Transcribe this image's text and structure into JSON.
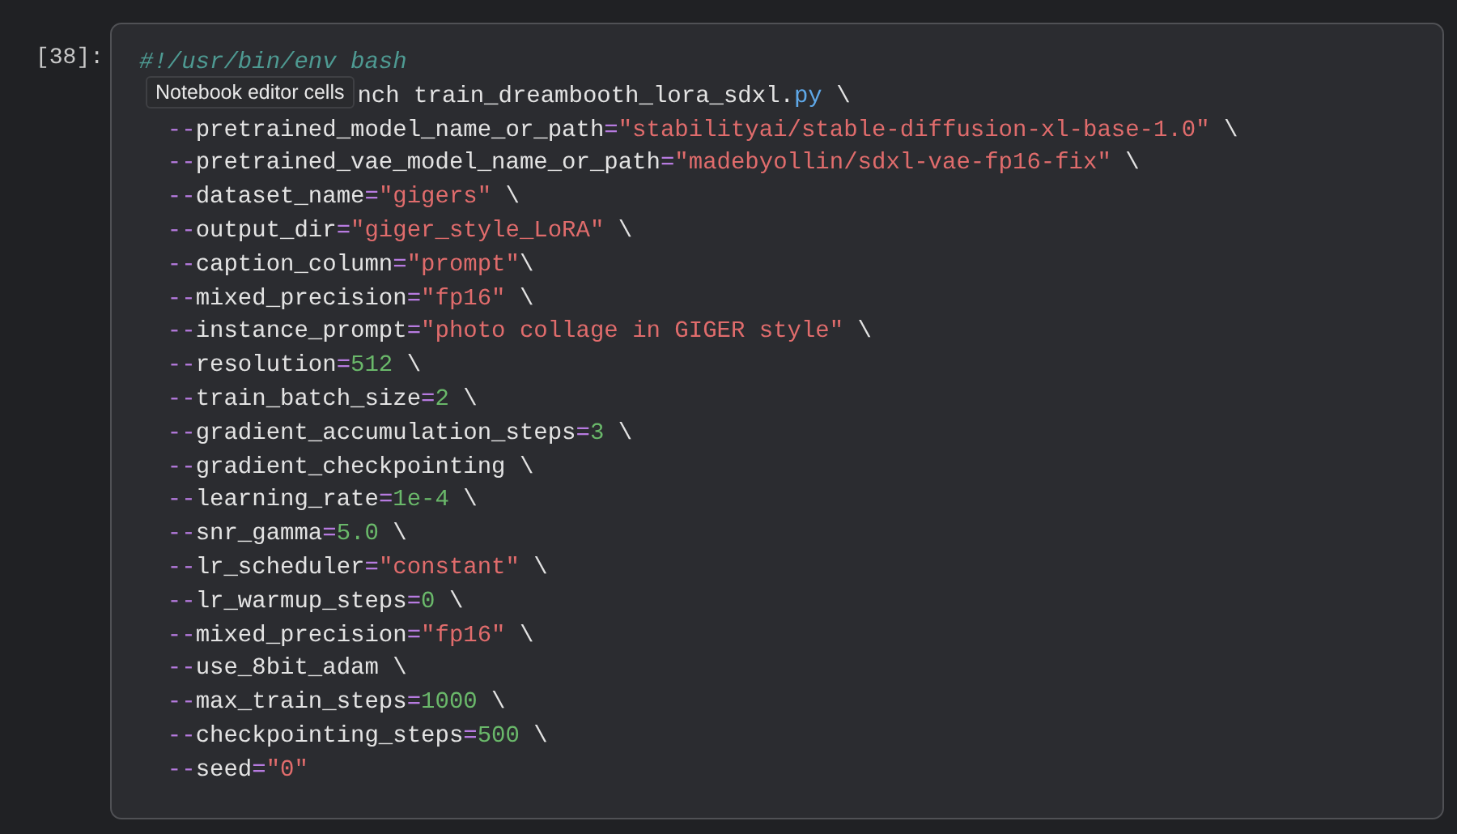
{
  "cell": {
    "prompt": "[38]:",
    "lines": [
      {
        "parts": [
          {
            "kind": "comment",
            "text": "#!/usr/bin/env bash"
          }
        ]
      },
      {
        "tooltip": "Notebook editor cells",
        "parts": [
          {
            "kind": "plain",
            "text": "nch train_dreambooth_lora_sdxl."
          },
          {
            "kind": "module",
            "text": "py"
          },
          {
            "kind": "plain",
            "text": " \\"
          }
        ]
      },
      {
        "parts": [
          {
            "kind": "operator",
            "text": "  --"
          },
          {
            "kind": "plain",
            "text": "pretrained_model_name_or_path"
          },
          {
            "kind": "operator",
            "text": "="
          },
          {
            "kind": "string",
            "text": "\"stabilityai/stable-diffusion-xl-base-1.0\""
          },
          {
            "kind": "plain",
            "text": " \\"
          }
        ]
      },
      {
        "parts": [
          {
            "kind": "operator",
            "text": "  --"
          },
          {
            "kind": "plain",
            "text": "pretrained_vae_model_name_or_path"
          },
          {
            "kind": "operator",
            "text": "="
          },
          {
            "kind": "string",
            "text": "\"madebyollin/sdxl-vae-fp16-fix\""
          },
          {
            "kind": "plain",
            "text": " \\"
          }
        ]
      },
      {
        "parts": [
          {
            "kind": "operator",
            "text": "  --"
          },
          {
            "kind": "plain",
            "text": "dataset_name"
          },
          {
            "kind": "operator",
            "text": "="
          },
          {
            "kind": "string",
            "text": "\"gigers\""
          },
          {
            "kind": "plain",
            "text": " \\"
          }
        ]
      },
      {
        "parts": [
          {
            "kind": "operator",
            "text": "  --"
          },
          {
            "kind": "plain",
            "text": "output_dir"
          },
          {
            "kind": "operator",
            "text": "="
          },
          {
            "kind": "string",
            "text": "\"giger_style_LoRA\""
          },
          {
            "kind": "plain",
            "text": " \\"
          }
        ]
      },
      {
        "parts": [
          {
            "kind": "operator",
            "text": "  --"
          },
          {
            "kind": "plain",
            "text": "caption_column"
          },
          {
            "kind": "operator",
            "text": "="
          },
          {
            "kind": "string",
            "text": "\"prompt\""
          },
          {
            "kind": "plain",
            "text": "\\"
          }
        ]
      },
      {
        "parts": [
          {
            "kind": "operator",
            "text": "  --"
          },
          {
            "kind": "plain",
            "text": "mixed_precision"
          },
          {
            "kind": "operator",
            "text": "="
          },
          {
            "kind": "string",
            "text": "\"fp16\""
          },
          {
            "kind": "plain",
            "text": " \\"
          }
        ]
      },
      {
        "parts": [
          {
            "kind": "operator",
            "text": "  --"
          },
          {
            "kind": "plain",
            "text": "instance_prompt"
          },
          {
            "kind": "operator",
            "text": "="
          },
          {
            "kind": "string",
            "text": "\"photo collage in GIGER style\""
          },
          {
            "kind": "plain",
            "text": " \\"
          }
        ]
      },
      {
        "parts": [
          {
            "kind": "operator",
            "text": "  --"
          },
          {
            "kind": "plain",
            "text": "resolution"
          },
          {
            "kind": "operator",
            "text": "="
          },
          {
            "kind": "number",
            "text": "512"
          },
          {
            "kind": "plain",
            "text": " \\"
          }
        ]
      },
      {
        "parts": [
          {
            "kind": "operator",
            "text": "  --"
          },
          {
            "kind": "plain",
            "text": "train_batch_size"
          },
          {
            "kind": "operator",
            "text": "="
          },
          {
            "kind": "number",
            "text": "2"
          },
          {
            "kind": "plain",
            "text": " \\"
          }
        ]
      },
      {
        "parts": [
          {
            "kind": "operator",
            "text": "  --"
          },
          {
            "kind": "plain",
            "text": "gradient_accumulation_steps"
          },
          {
            "kind": "operator",
            "text": "="
          },
          {
            "kind": "number",
            "text": "3"
          },
          {
            "kind": "plain",
            "text": " \\"
          }
        ]
      },
      {
        "parts": [
          {
            "kind": "operator",
            "text": "  --"
          },
          {
            "kind": "plain",
            "text": "gradient_checkpointing \\"
          }
        ]
      },
      {
        "parts": [
          {
            "kind": "operator",
            "text": "  --"
          },
          {
            "kind": "plain",
            "text": "learning_rate"
          },
          {
            "kind": "operator",
            "text": "="
          },
          {
            "kind": "number",
            "text": "1e-4"
          },
          {
            "kind": "plain",
            "text": " \\"
          }
        ]
      },
      {
        "parts": [
          {
            "kind": "operator",
            "text": "  --"
          },
          {
            "kind": "plain",
            "text": "snr_gamma"
          },
          {
            "kind": "operator",
            "text": "="
          },
          {
            "kind": "number",
            "text": "5.0"
          },
          {
            "kind": "plain",
            "text": " \\"
          }
        ]
      },
      {
        "parts": [
          {
            "kind": "operator",
            "text": "  --"
          },
          {
            "kind": "plain",
            "text": "lr_scheduler"
          },
          {
            "kind": "operator",
            "text": "="
          },
          {
            "kind": "string",
            "text": "\"constant\""
          },
          {
            "kind": "plain",
            "text": " \\"
          }
        ]
      },
      {
        "parts": [
          {
            "kind": "operator",
            "text": "  --"
          },
          {
            "kind": "plain",
            "text": "lr_warmup_steps"
          },
          {
            "kind": "operator",
            "text": "="
          },
          {
            "kind": "number",
            "text": "0"
          },
          {
            "kind": "plain",
            "text": " \\"
          }
        ]
      },
      {
        "parts": [
          {
            "kind": "operator",
            "text": "  --"
          },
          {
            "kind": "plain",
            "text": "mixed_precision"
          },
          {
            "kind": "operator",
            "text": "="
          },
          {
            "kind": "string",
            "text": "\"fp16\""
          },
          {
            "kind": "plain",
            "text": " \\"
          }
        ]
      },
      {
        "parts": [
          {
            "kind": "operator",
            "text": "  --"
          },
          {
            "kind": "plain",
            "text": "use_8bit_adam \\"
          }
        ]
      },
      {
        "parts": [
          {
            "kind": "operator",
            "text": "  --"
          },
          {
            "kind": "plain",
            "text": "max_train_steps"
          },
          {
            "kind": "operator",
            "text": "="
          },
          {
            "kind": "number",
            "text": "1000"
          },
          {
            "kind": "plain",
            "text": " \\"
          }
        ]
      },
      {
        "parts": [
          {
            "kind": "operator",
            "text": "  --"
          },
          {
            "kind": "plain",
            "text": "checkpointing_steps"
          },
          {
            "kind": "operator",
            "text": "="
          },
          {
            "kind": "number",
            "text": "500"
          },
          {
            "kind": "plain",
            "text": " \\"
          }
        ]
      },
      {
        "parts": [
          {
            "kind": "operator",
            "text": "  --"
          },
          {
            "kind": "plain",
            "text": "seed"
          },
          {
            "kind": "operator",
            "text": "="
          },
          {
            "kind": "string",
            "text": "\"0\""
          }
        ]
      }
    ]
  }
}
